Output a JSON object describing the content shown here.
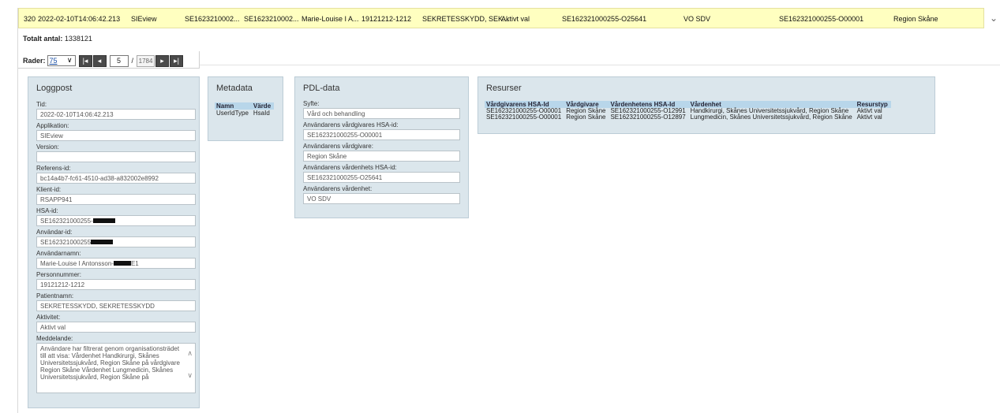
{
  "top_row": {
    "index": "320",
    "timestamp": "2022-02-10T14:06:42.213",
    "application": "SIEview",
    "col3": "SE1623210002...",
    "col4": "SE1623210002...",
    "user": "Marie-Louise I A...",
    "personnummer": "19121212-1212",
    "patient": "SEKRETESSKYDD, SEK...",
    "activity": "Aktivt val",
    "unit_hsa": "SE162321000255-O25641",
    "unit": "VO SDV",
    "provider_hsa": "SE162321000255-O00001",
    "provider": "Region Skåne"
  },
  "summary": {
    "total_label": "Totalt antal:",
    "total_value": "1338121"
  },
  "pager": {
    "rows_label": "Rader:",
    "rows_value": "75",
    "first_icon": "|◂",
    "prev_icon": "◂",
    "page": "5",
    "separator": "/",
    "page_total": "1784",
    "next_icon": "▸",
    "last_icon": "▸|"
  },
  "loggpost": {
    "title": "Loggpost",
    "fields": {
      "tid_label": "Tid:",
      "tid": "2022-02-10T14:06:42.213",
      "app_label": "Applikation:",
      "app": "SIEview",
      "version_label": "Version:",
      "version": "",
      "ref_label": "Referens-id:",
      "ref": "bc14a4b7-fc61-4510-ad38-a832002e8992",
      "klient_label": "Klient-id:",
      "klient": "RSAPP941",
      "hsa_label": "HSA-id:",
      "hsa": "SE162321000255-",
      "anvid_label": "Användar-id:",
      "anvid": "SE162321000255",
      "anvnamn_label": "Användarnamn:",
      "anvnamn_a": "Marie-Louise I Antonsson-",
      "anvnamn_b": "E1",
      "pnr_label": "Personnummer:",
      "pnr": "19121212-1212",
      "patnamn_label": "Patientnamn:",
      "patnamn": "SEKRETESSKYDD, SEKRETESSKYDD",
      "aktivitet_label": "Aktivitet:",
      "aktivitet": "Aktivt val",
      "medd_label": "Meddelande:",
      "medd": "Användare har filtrerat genom organisationsträdet till att visa: Vårdenhet Handkirurgi, Skånes Universitetssjukvård, Region Skåne på vårdgivare Region Skåne Vårdenhet Lungmedicin, Skånes Universitetssjukvård, Region Skåne på"
    }
  },
  "metadata": {
    "title": "Metadata",
    "headers": [
      "Namn",
      "Värde"
    ],
    "rows": [
      [
        "UserIdType",
        "HsaId"
      ]
    ]
  },
  "pdl": {
    "title": "PDL-data",
    "syfte_label": "Syfte:",
    "syfte": "Vård och behandling",
    "vg_hsa_label": "Användarens vårdgivares HSA-id:",
    "vg_hsa": "SE162321000255-O00001",
    "vg_label": "Användarens vårdgivare:",
    "vg": "Region Skåne",
    "ve_hsa_label": "Användarens vårdenhets HSA-id:",
    "ve_hsa": "SE162321000255-O25641",
    "ve_label": "Användarens vårdenhet:",
    "ve": "VO SDV"
  },
  "resurser": {
    "title": "Resurser",
    "headers": [
      "Vårdgivarens HSA-Id",
      "Vårdgivare",
      "Vårdenhetens HSA-Id",
      "Vårdenhet",
      "Resurstyp"
    ],
    "rows": [
      [
        "SE162321000255-O00001",
        "Region Skåne",
        "SE162321000255-O12991",
        "Handkirurgi, Skånes Universitetssjukvård, Region Skåne",
        "Aktivt val"
      ],
      [
        "SE162321000255-O00001",
        "Region Skåne",
        "SE162321000255-O12897",
        "Lungmedicin, Skånes Universitetssjukvård, Region Skåne",
        "Aktivt val"
      ]
    ]
  },
  "icons": {
    "row_scroll": "chevron-down-icon",
    "textarea_up": "chevron-up-icon",
    "textarea_down": "chevron-down-icon"
  }
}
